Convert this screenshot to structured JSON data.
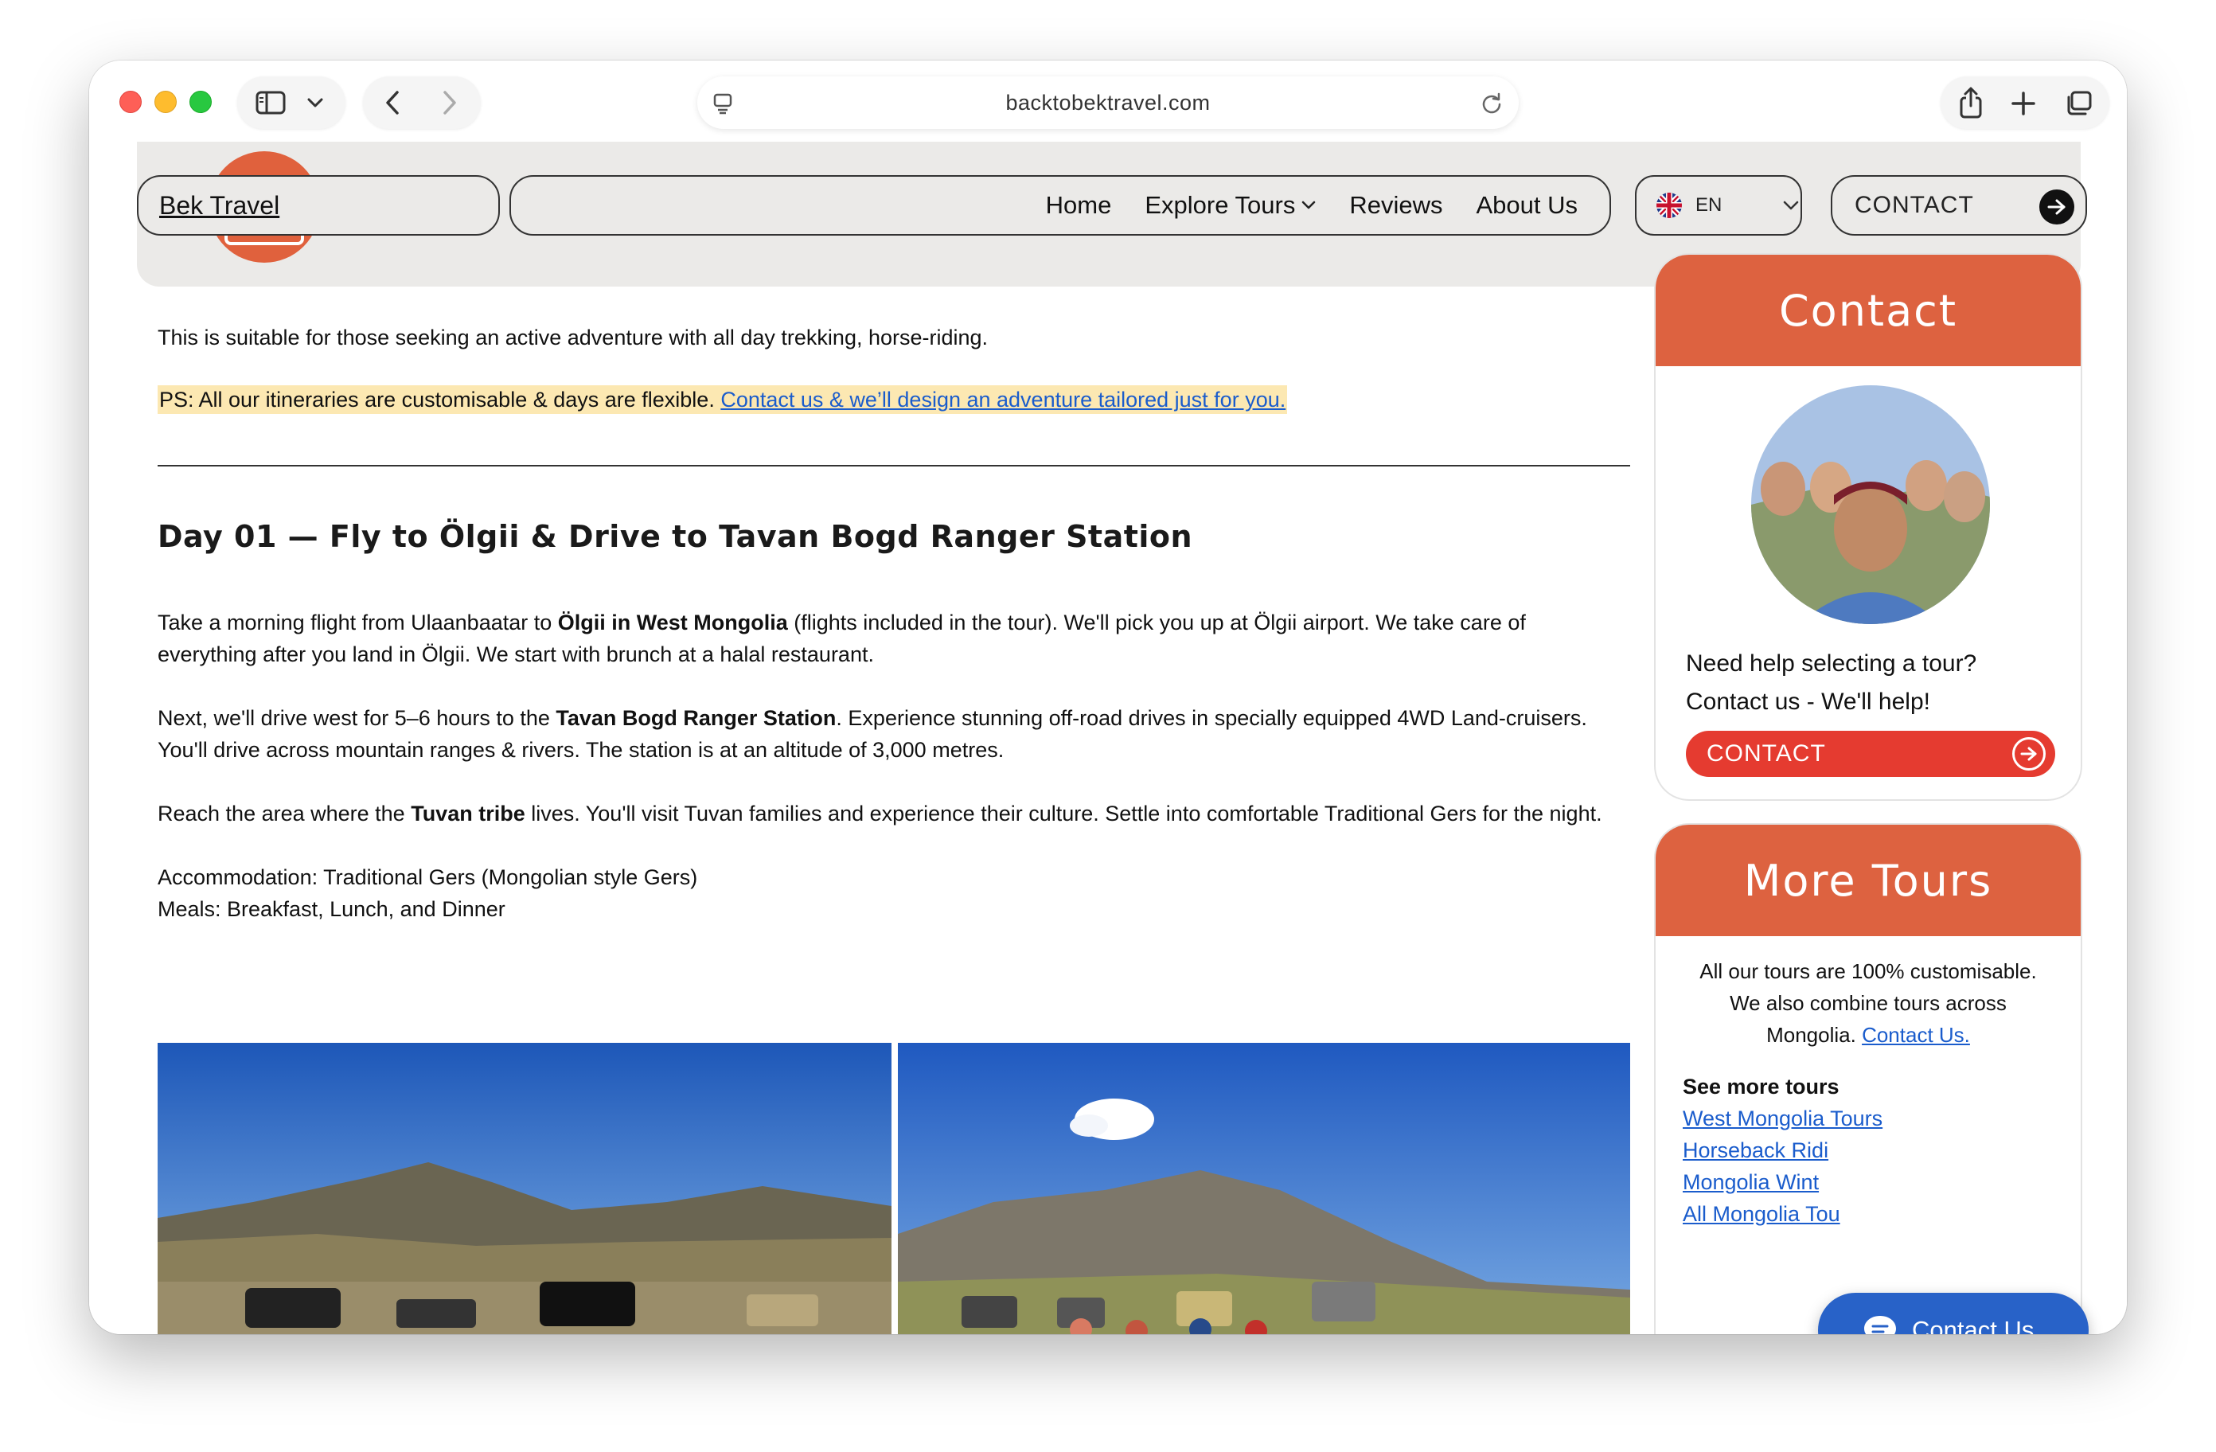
{
  "browser": {
    "url": "backtobektravel.com"
  },
  "header": {
    "brand": "Bek Travel",
    "nav": [
      "Home",
      "Explore Tours",
      "Reviews",
      "About Us"
    ],
    "language": "EN",
    "contact": "CONTACT"
  },
  "main": {
    "intro": "This is suitable for those seeking an active adventure with all day trekking, horse-riding.",
    "ps_text": "PS: All our itineraries are customisable & days are flexible. ",
    "ps_link": "Contact us & we’ll design an adventure tailored just for you.",
    "day_title": "Day 01 — Fly to Ölgii & Drive to Tavan Bogd Ranger Station",
    "p1_a": "Take a morning flight from Ulaanbaatar to ",
    "p1_b": "Ölgii in West Mongolia",
    "p1_c": " (flights included in the tour). We'll pick you up at Ölgii airport. We take care of",
    "p1_d": "everything after you land in Ölgii. We start with brunch at a halal restaurant.",
    "p2_a": "Next, we'll drive west for 5–6 hours to the ",
    "p2_b": "Tavan Bogd Ranger Station",
    "p2_c": ". Experience stunning off-road drives in specially equipped 4WD Land-cruisers.",
    "p2_d": "You'll drive across mountain ranges & rivers. The station is at an altitude of 3,000 metres.",
    "p3_a": "Reach the area where the ",
    "p3_b": "Tuvan tribe",
    "p3_c": " lives. You'll visit Tuvan families and experience their culture. Settle into comfortable Traditional Gers for the night.",
    "accommodation": "Accommodation: Traditional Gers (Mongolian style Gers)",
    "meals": "Meals: Breakfast, Lunch, and Dinner"
  },
  "sidebar": {
    "contact_title": "Contact",
    "help_line1": "Need help selecting a tour?",
    "help_line2": "Contact us - We'll help!",
    "contact_button": "CONTACT",
    "tours_title": "More Tours",
    "tours_line1": "All our tours are 100% customisable.",
    "tours_line2": "We also combine tours across",
    "tours_line3": "Mongolia. ",
    "tours_link": "Contact Us.",
    "see_more": "See more tours",
    "links": [
      "West Mongolia Tours",
      "Horseback Ridi",
      "Mongolia Wint",
      "All Mongolia Tou"
    ]
  },
  "chat": {
    "label": "Contact Us"
  },
  "colors": {
    "accent": "#dd6240",
    "button_red": "#e53b30",
    "link": "#1a5ccc",
    "chat_blue": "#2862c8"
  }
}
